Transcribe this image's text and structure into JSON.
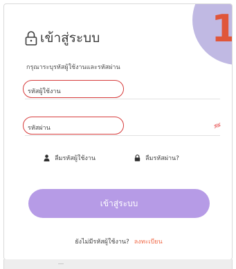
{
  "badge": {
    "number": "1"
  },
  "login": {
    "title": "เข้าสู่ระบบ",
    "subtitle": "กรุณาระบุรหัสผู้ใช้งานและรหัสผ่าน",
    "username_placeholder": "รหัสผู้ใช้งาน",
    "password_placeholder": "รหัสผ่าน",
    "forgot_username": "ลืมรหัสผู้ใช้งาน",
    "forgot_password": "ลืมรหัสผ่าน?",
    "submit_label": "เข้าสู่ระบบ",
    "signup_prompt": "ยังไม่มีรหัสผู้ใช้งาน?",
    "signup_link": "ลงทะเบียน"
  },
  "icons": {
    "lock": "lock-icon",
    "password_toggle": "eye-slash-icon",
    "user": "user-icon",
    "small_lock": "lock-icon"
  },
  "colors": {
    "accent_button": "#b69be6",
    "badge_circle": "#c0b9e3",
    "badge_number": "#e0563a",
    "highlight_ring": "#d63a3a",
    "signup_link": "#f06a48"
  }
}
